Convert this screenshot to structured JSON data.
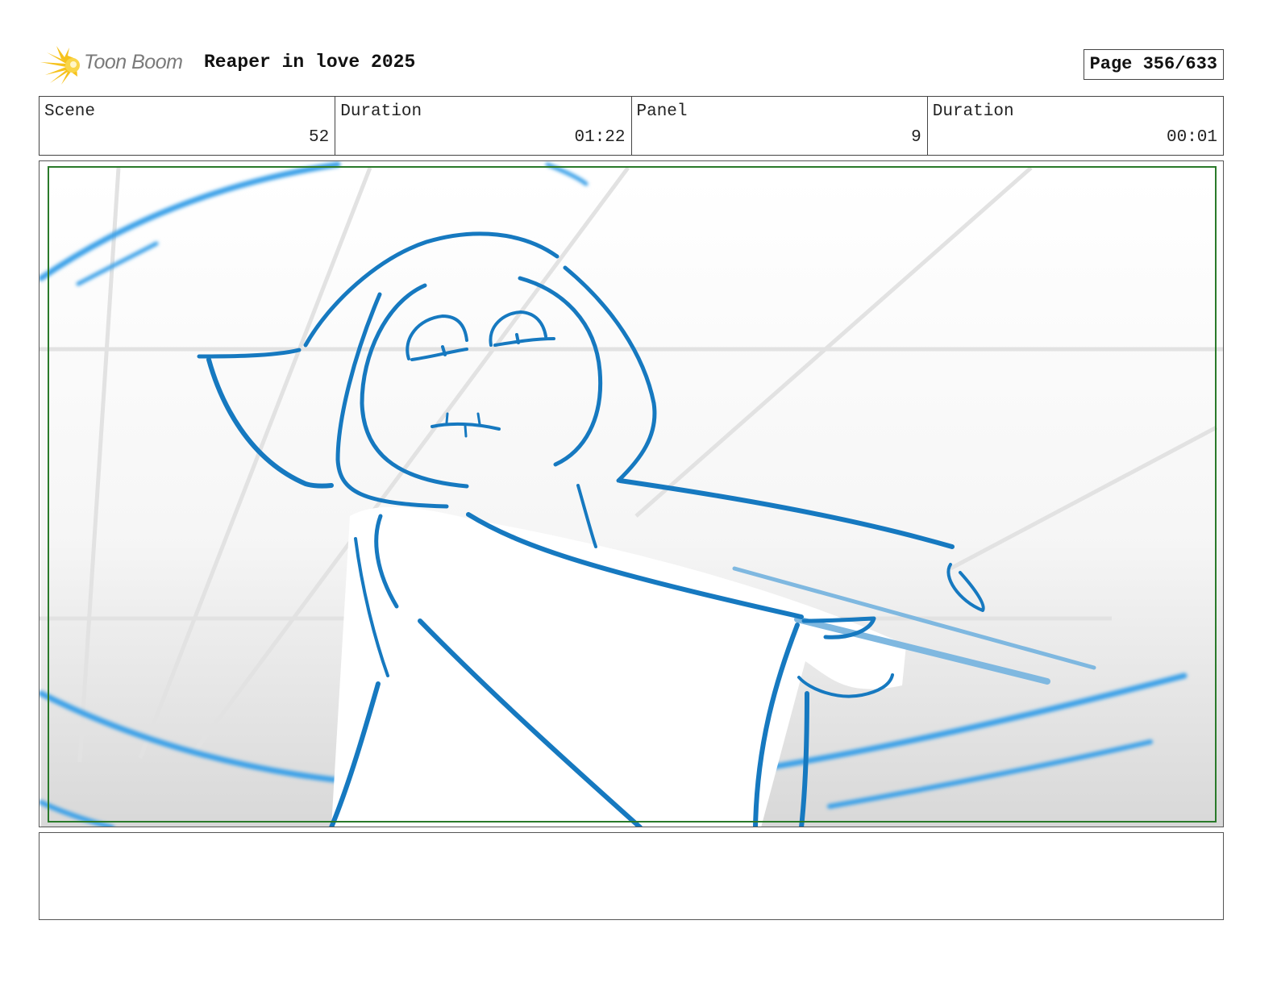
{
  "header": {
    "brand": "Toon Boom",
    "project_title": "Reaper in love 2025",
    "page_label": "Page 356/633"
  },
  "info": [
    {
      "label": "Scene",
      "value": "52"
    },
    {
      "label": "Duration",
      "value": "01:22"
    },
    {
      "label": "Panel",
      "value": "9"
    },
    {
      "label": "Duration",
      "value": "00:01"
    }
  ],
  "colors": {
    "sketch_line": "#1679c0",
    "motion_streak": "#3aa0e8",
    "safe_frame": "#2a7a2a"
  },
  "notes": {
    "text": ""
  }
}
